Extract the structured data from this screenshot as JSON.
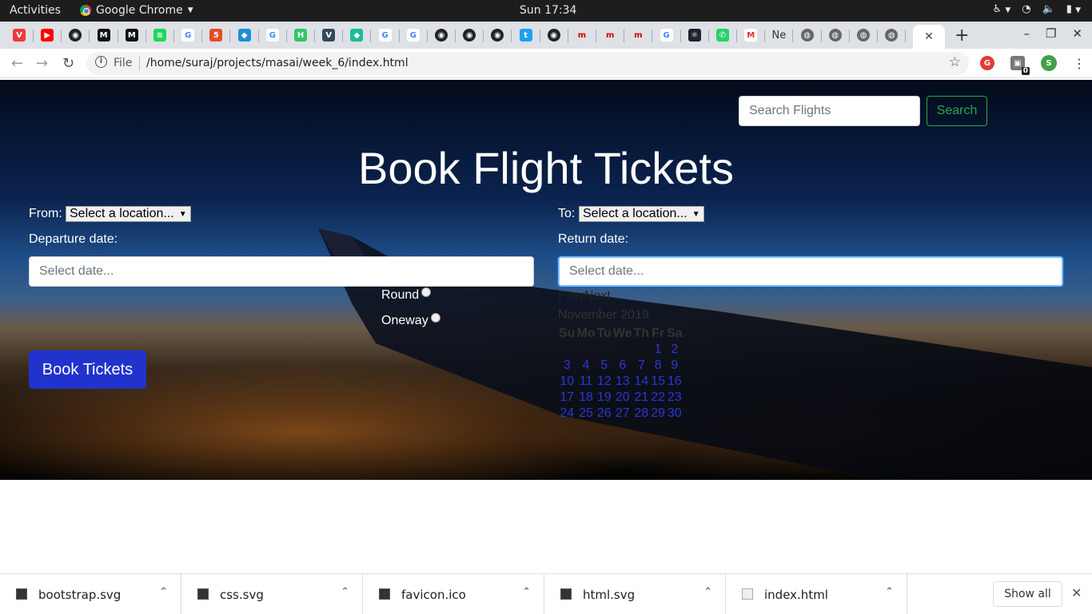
{
  "topbar": {
    "activities": "Activities",
    "app_name": "Google Chrome",
    "clock": "Sun 17:34"
  },
  "browser": {
    "tabs_favicons": [
      "vivaldi",
      "youtube",
      "github",
      "medium",
      "medium",
      "spotify",
      "google",
      "html5",
      "codepen",
      "google",
      "hackerrank",
      "vue",
      "dev-diamond",
      "google",
      "google",
      "github",
      "github",
      "github",
      "twitter",
      "github",
      "masai",
      "masai",
      "masai",
      "google",
      "react",
      "whatsapp",
      "gmail",
      "ne-tab",
      "globe",
      "globe",
      "globe",
      "globe"
    ],
    "ne_tab_label": "Ne",
    "address": {
      "info_label": "i",
      "scheme_label": "File",
      "url": "/home/suraj/projects/masai/week_6/index.html"
    },
    "profile_initial": "S",
    "extension_badge": "0"
  },
  "page": {
    "search": {
      "placeholder": "Search Flights",
      "button": "Search"
    },
    "title": "Book Flight Tickets",
    "from_label": "From:",
    "from_value": "Select a location...",
    "to_label": "To:",
    "to_value": "Select a location...",
    "departure_label": "Departure date:",
    "departure_placeholder": "Select date...",
    "return_label": "Return date:",
    "return_placeholder": "Select date...",
    "trip_type": {
      "round": "Round",
      "oneway": "Oneway"
    },
    "book_button": "Book Tickets",
    "calendar": {
      "prev": "Prev",
      "next": "Next",
      "month": "November 2019",
      "weekdays": [
        "Su",
        "Mo",
        "Tu",
        "We",
        "Th",
        "Fr",
        "Sa"
      ],
      "weeks": [
        [
          "",
          "",
          "",
          "",
          "",
          "1",
          "2"
        ],
        [
          "3",
          "4",
          "5",
          "6",
          "7",
          "8",
          "9"
        ],
        [
          "10",
          "11",
          "12",
          "13",
          "14",
          "15",
          "16"
        ],
        [
          "17",
          "18",
          "19",
          "20",
          "21",
          "22",
          "23"
        ],
        [
          "24",
          "25",
          "26",
          "27",
          "28",
          "29",
          "30"
        ]
      ]
    }
  },
  "downloads": {
    "items": [
      "bootstrap.svg",
      "css.svg",
      "favicon.ico",
      "html.svg",
      "index.html"
    ],
    "show_all": "Show all"
  },
  "colors": {
    "primary_button": "#2233cc",
    "search_button": "#28a745",
    "calendar_day": "#2a37d6"
  }
}
